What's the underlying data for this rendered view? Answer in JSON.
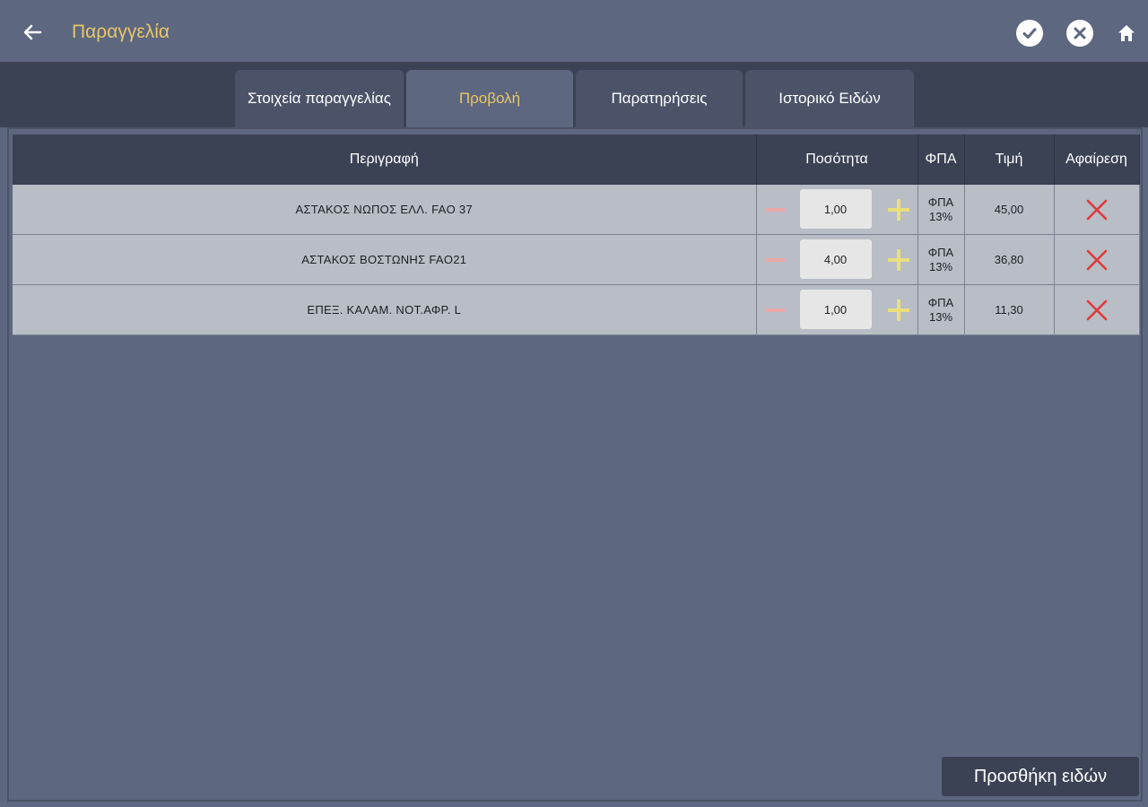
{
  "header": {
    "title": "Παραγγελία",
    "back_icon": "arrow-left-icon",
    "actions": [
      "check-circle-icon",
      "close-circle-icon",
      "home-icon"
    ],
    "accent_color": "#e8c766"
  },
  "tabs": [
    {
      "label": "Στοιχεία παραγγελίας",
      "active": false
    },
    {
      "label": "Προβολή",
      "active": true
    },
    {
      "label": "Παρατηρήσεις",
      "active": false
    },
    {
      "label": "Ιστορικό Ειδών",
      "active": false
    }
  ],
  "table": {
    "columns": [
      "Περιγραφή",
      "Ποσότητα",
      "ΦΠΑ",
      "Τιμή",
      "Αφαίρεση"
    ],
    "rows": [
      {
        "description": "ΑΣΤΑΚΟΣ ΝΩΠΟΣ ΕΛΛ. FAO 37",
        "quantity": "1,00",
        "vat_line1": "ΦΠΑ",
        "vat_line2": "13%",
        "price": "45,00"
      },
      {
        "description": "ΑΣΤΑΚΟΣ ΒΟΣΤΩΝΗΣ FAO21",
        "quantity": "4,00",
        "vat_line1": "ΦΠΑ",
        "vat_line2": "13%",
        "price": "36,80"
      },
      {
        "description": "ΕΠΕΞ. ΚΑΛΑΜ. ΝΟΤ.ΑΦΡ. L",
        "quantity": "1,00",
        "vat_line1": "ΦΠΑ",
        "vat_line2": "13%",
        "price": "11,30"
      }
    ],
    "colors": {
      "minus": "#eba7a7",
      "plus": "#e9e07a",
      "remove": "#e03a3a"
    }
  },
  "add_items_button": "Προσθήκη ειδών"
}
